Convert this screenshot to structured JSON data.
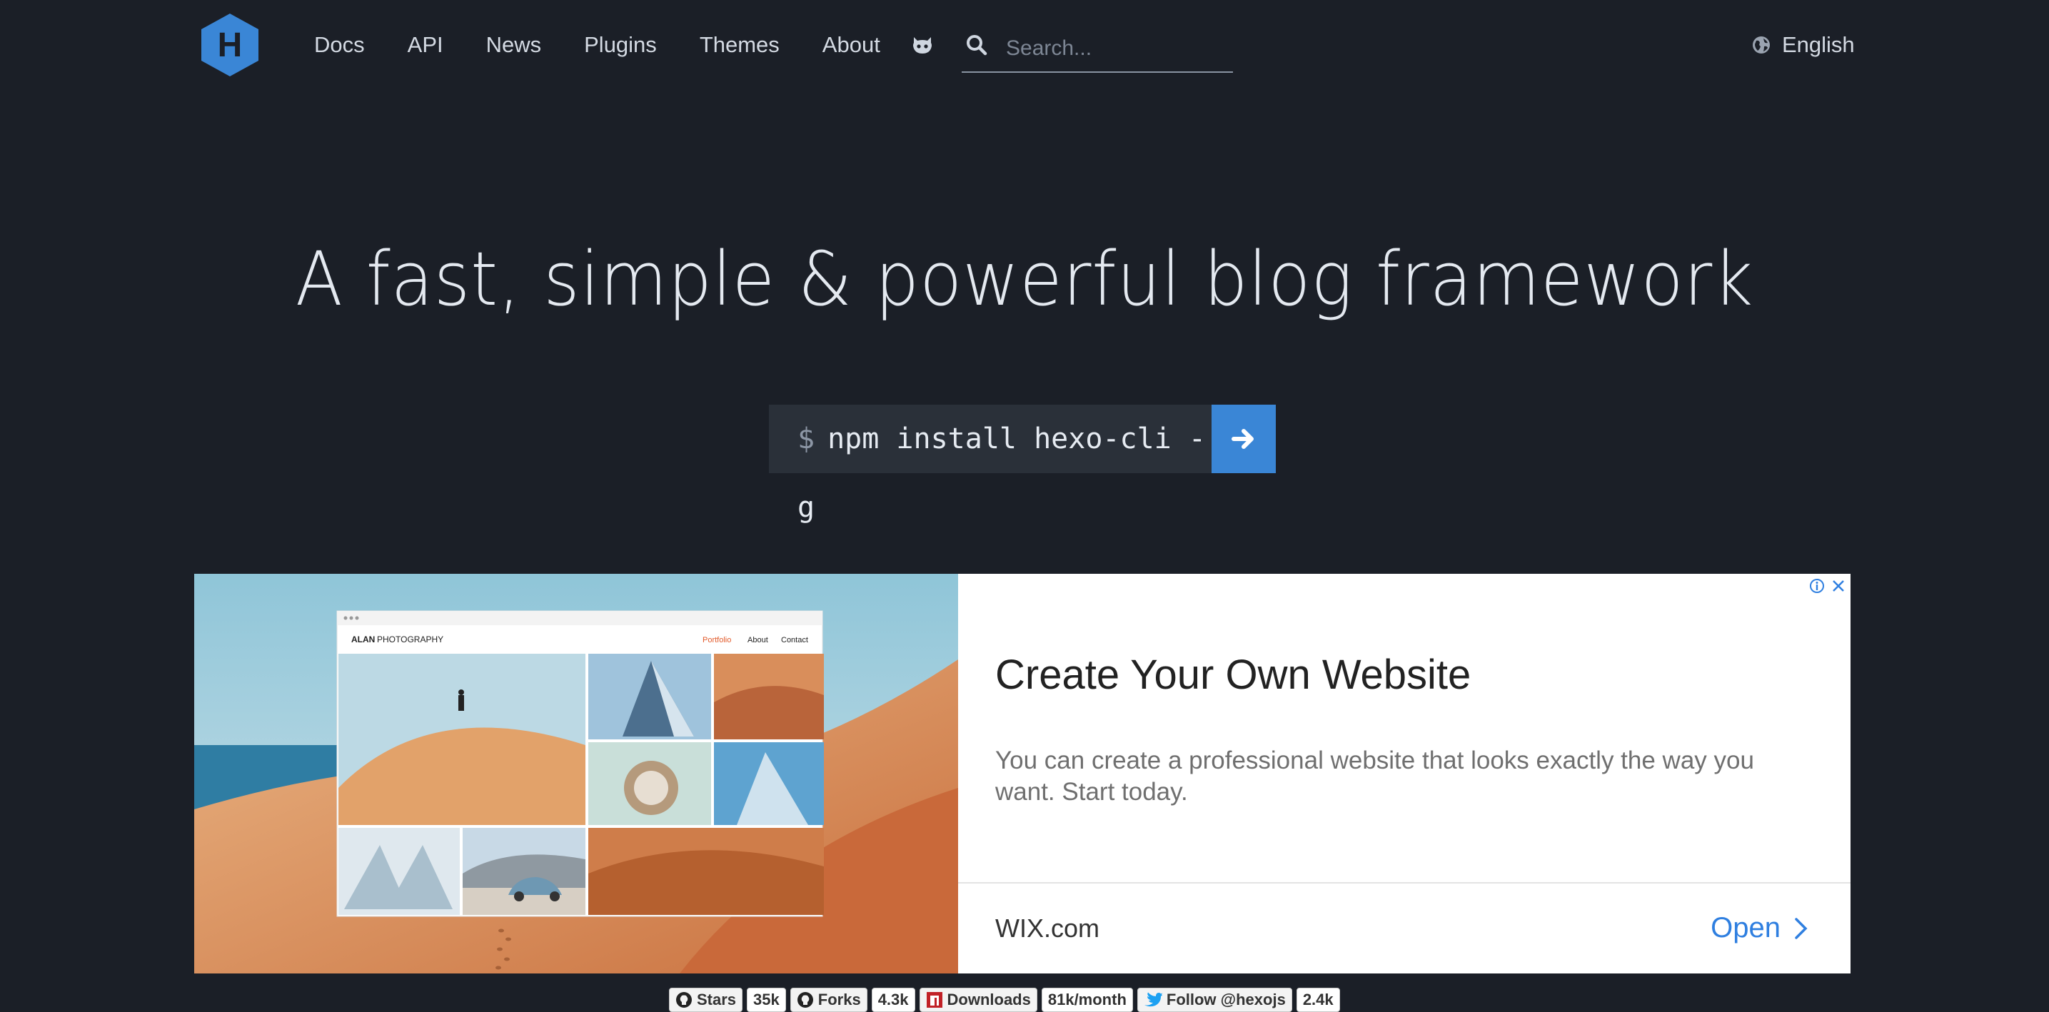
{
  "colors": {
    "background": "#1b1f27",
    "accent": "#3a86d6",
    "command_bg": "#2a3039",
    "ad_link": "#2f7fe0"
  },
  "header": {
    "logo_letter": "H",
    "nav": [
      "Docs",
      "API",
      "News",
      "Plugins",
      "Themes",
      "About"
    ],
    "github_icon": "octocat-icon",
    "search": {
      "placeholder": "Search...",
      "value": ""
    },
    "language": "English"
  },
  "hero": {
    "title": "A fast, simple & powerful blog framework",
    "prompt": "$",
    "command": "npm install hexo-cli -g",
    "go_icon": "arrow-right-icon"
  },
  "ad": {
    "mockup_brand": "ALAN",
    "mockup_brand_rest": "PHOTOGRAPHY",
    "mockup_nav": [
      "Portfolio",
      "About",
      "Contact"
    ],
    "heading": "Create Your Own Website",
    "text": "You can create a professional website that looks exactly the way you want. Start today.",
    "brand": "WIX.com",
    "cta": "Open"
  },
  "badges": [
    {
      "label": "Stars",
      "count": "35k",
      "icon": "github-icon"
    },
    {
      "label": "Forks",
      "count": "4.3k",
      "icon": "github-icon"
    },
    {
      "label": "Downloads",
      "count": "81k/month",
      "icon": "npm-icon"
    },
    {
      "label": "Follow @hexojs",
      "count": "2.4k",
      "icon": "twitter-icon"
    }
  ]
}
